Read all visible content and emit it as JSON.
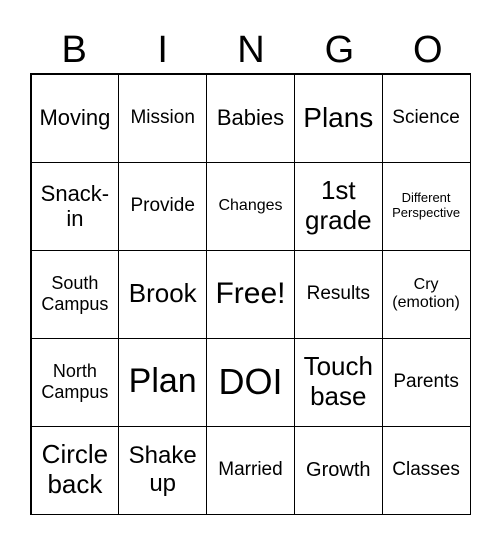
{
  "header": [
    "B",
    "I",
    "N",
    "G",
    "O"
  ],
  "cells": [
    [
      "Moving",
      "Mission",
      "Babies",
      "Plans",
      "Science"
    ],
    [
      "Snack-\nin",
      "Provide",
      "Changes",
      "1st\ngrade",
      "Different\nPerspective"
    ],
    [
      "South\nCampus",
      "Brook",
      "Free!",
      "Results",
      "Cry\n(emotion)"
    ],
    [
      "North\nCampus",
      "Plan",
      "DOI",
      "Touch\nbase",
      "Parents"
    ],
    [
      "Circle\nback",
      "Shake\nup",
      "Married",
      "Growth",
      "Classes"
    ]
  ]
}
